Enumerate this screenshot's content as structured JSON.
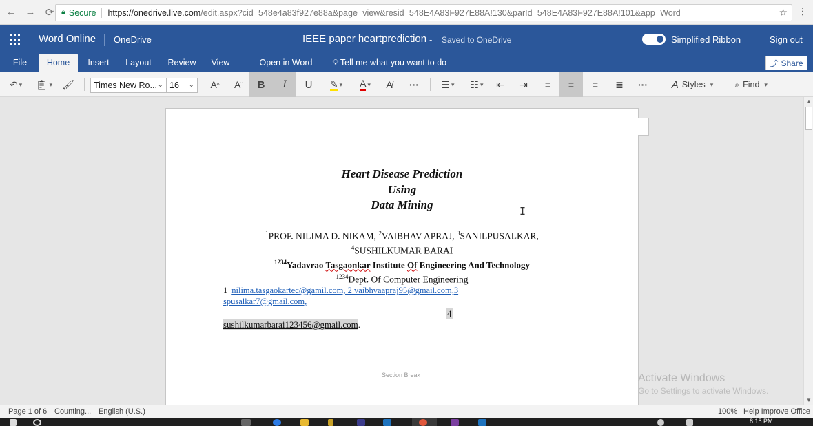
{
  "browser": {
    "secure_label": "Secure",
    "url_host": "https://onedrive.live.com",
    "url_path": "/edit.aspx?cid=548e4a83f927e88a&page=view&resid=548E4A83F927E88A!130&parId=548E4A83F927E88A!101&app=Word"
  },
  "header": {
    "app_name": "Word Online",
    "onedrive_label": "OneDrive",
    "doc_title": "IEEE paper heartprediction",
    "dash": "-",
    "save_status": "Saved to OneDrive",
    "ribbon_toggle_label": "Simplified Ribbon",
    "sign_out": "Sign out"
  },
  "tabs": [
    {
      "label": "File"
    },
    {
      "label": "Home"
    },
    {
      "label": "Insert"
    },
    {
      "label": "Layout"
    },
    {
      "label": "Review"
    },
    {
      "label": "View"
    },
    {
      "label": "Open in Word"
    },
    {
      "label": "Tell me what you want to do"
    }
  ],
  "share_label": "Share",
  "toolbar": {
    "font_name": "Times New Ro...",
    "font_size": "16",
    "grow_font": "A",
    "shrink_font": "A",
    "bold": "B",
    "italic": "I",
    "underline": "U",
    "font_color_glyph": "A",
    "more": "···",
    "styles_label": "Styles",
    "find_label": "Find"
  },
  "document": {
    "title_lines": [
      "Heart Disease Prediction",
      "Using",
      "Data Mining"
    ],
    "authors_line1": {
      "s1": "1",
      "t1": "PROF. NILIMA D. NIKAM, ",
      "s2": "2",
      "t2": "VAIBHAV APRAJ, ",
      "s3": "3",
      "t3": "SANILPUSALKAR,"
    },
    "authors_line2": {
      "s4": "4",
      "t4": "SUSHILKUMAR BARAI"
    },
    "institute": {
      "sup": "1234",
      "pre": "Yadavrao ",
      "w1": "Tasgaonkar",
      "mid": " Institute ",
      "w2": "Of",
      "post": " Engineering And Technology"
    },
    "dept": {
      "sup": "1234",
      "text": "Dept. Of Computer Engineering"
    },
    "emails_line1": {
      "num": "1",
      "links": "nilima.tasgaokartec@gamil.com, 2 vaibhvaapraj95@gmail.com,3"
    },
    "emails_line2": "spusalkar7@gmail.com,",
    "four": "4",
    "email_last": "sushilkumarbarai123456@gmail.com",
    "email_last_suffix": ".",
    "section_break": "Section Break"
  },
  "watermark": {
    "line1": "Activate Windows",
    "line2": "Go to Settings to activate Windows."
  },
  "status": {
    "page": "Page 1 of 6",
    "words": "Counting...",
    "language": "English (U.S.)",
    "zoom": "100%",
    "help": "Help Improve Office"
  },
  "taskbar": {
    "clock": "8:15 PM"
  },
  "colors": {
    "word_blue": "#2b579a",
    "link_blue": "#1f5fb8",
    "secure_green": "#0b8043"
  }
}
